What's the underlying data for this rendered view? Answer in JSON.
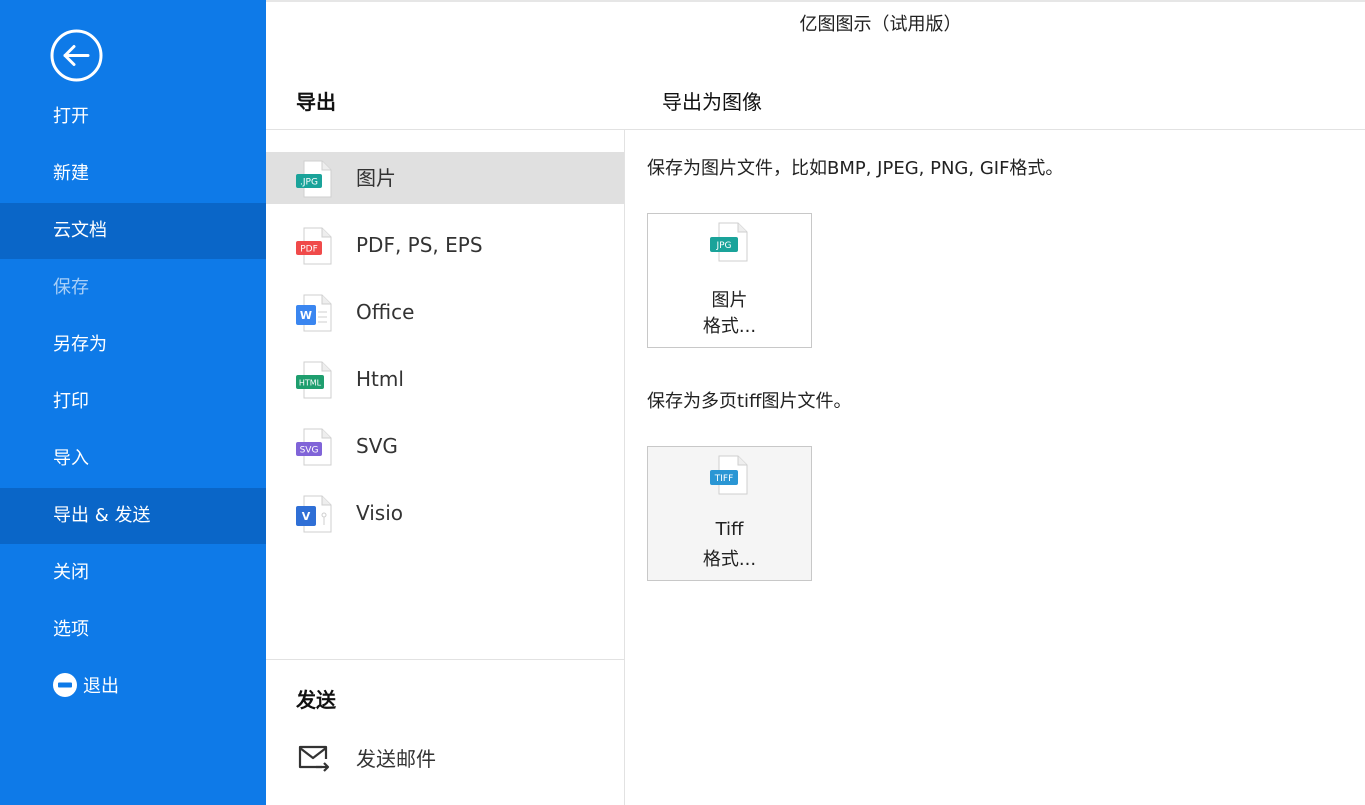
{
  "window": {
    "title": "亿图图示（试用版）"
  },
  "sidebar": {
    "items": [
      {
        "label": "打开",
        "state": "normal"
      },
      {
        "label": "新建",
        "state": "normal"
      },
      {
        "label": "云文档",
        "state": "active"
      },
      {
        "label": "保存",
        "state": "disabled"
      },
      {
        "label": "另存为",
        "state": "normal"
      },
      {
        "label": "打印",
        "state": "normal"
      },
      {
        "label": "导入",
        "state": "normal"
      },
      {
        "label": "导出 & 发送",
        "state": "active"
      },
      {
        "label": "关闭",
        "state": "normal"
      },
      {
        "label": "选项",
        "state": "normal"
      },
      {
        "label": "退出",
        "state": "normal"
      }
    ]
  },
  "export_section": {
    "heading": "导出",
    "formats": [
      {
        "label": "图片",
        "icon": "jpg-file-icon",
        "badge": "JPG",
        "color": "#1aa39a",
        "selected": true
      },
      {
        "label": "PDF, PS, EPS",
        "icon": "pdf-file-icon",
        "badge": "PDF",
        "color": "#f04a4a",
        "selected": false
      },
      {
        "label": "Office",
        "icon": "word-file-icon",
        "badge": "W",
        "color": "#3a86f0",
        "selected": false
      },
      {
        "label": "Html",
        "icon": "html-file-icon",
        "badge": "HTML",
        "color": "#1e9e6e",
        "selected": false
      },
      {
        "label": "SVG",
        "icon": "svg-file-icon",
        "badge": "SVG",
        "color": "#8064d8",
        "selected": false
      },
      {
        "label": "Visio",
        "icon": "visio-file-icon",
        "badge": "V",
        "color": "#2f6fd6",
        "selected": false
      }
    ]
  },
  "send_section": {
    "heading": "发送",
    "email_label": "发送邮件"
  },
  "detail": {
    "heading": "导出为图像",
    "image_desc": "保存为图片文件，比如BMP, JPEG, PNG, GIF格式。",
    "image_card": {
      "line1": "图片",
      "line2": "格式...",
      "badge": "JPG"
    },
    "tiff_desc": "保存为多页tiff图片文件。",
    "tiff_card": {
      "line1": "Tiff",
      "line2": "格式...",
      "badge": "TIFF"
    }
  },
  "colors": {
    "sidebar": "#0e7ae8",
    "sidebar_active": "#0a66c8",
    "selected_row": "#e0e0e0"
  }
}
